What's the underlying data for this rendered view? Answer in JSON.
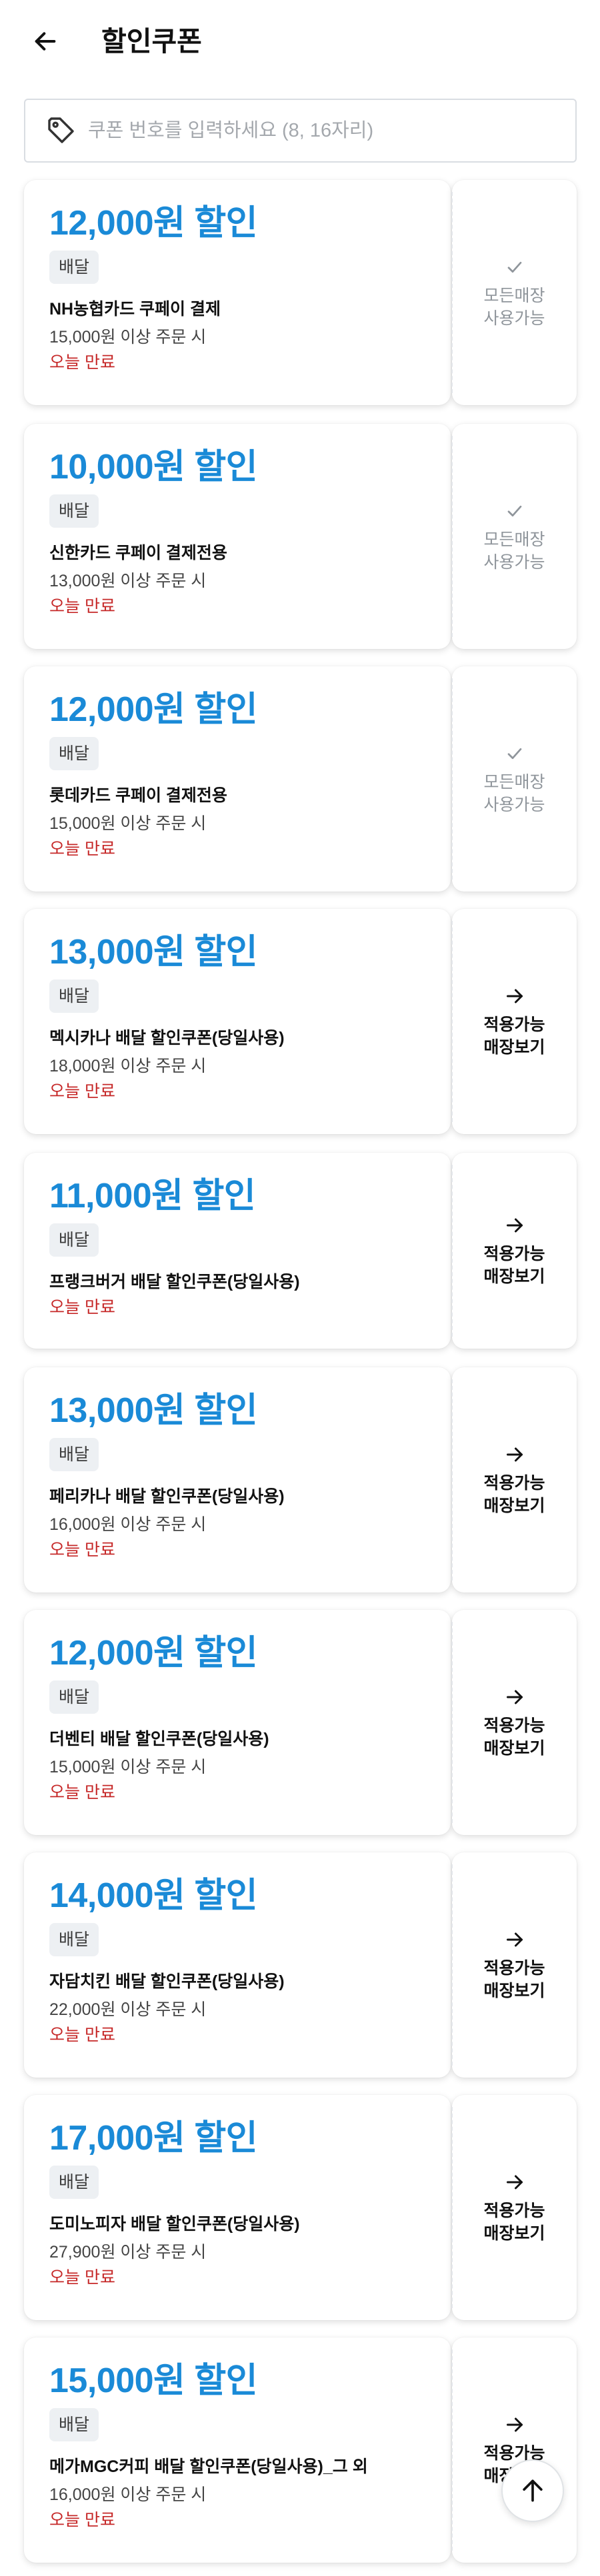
{
  "header": {
    "title": "할인쿠폰",
    "back_icon": "arrow-left-icon"
  },
  "search": {
    "placeholder": "쿠폰 번호를 입력하세요 (8, 16자리)",
    "value": "",
    "icon": "tag-icon"
  },
  "coupons": [
    {
      "amount": "12,000원 할인",
      "type": "배달",
      "name": "NH농협카드 쿠페이 결제",
      "min_order": "15,000원 이상 주문 시",
      "expiry": "오늘 만료",
      "side": {
        "kind": "all",
        "icon": "check-icon",
        "line1": "모든매장",
        "line2": "사용가능"
      }
    },
    {
      "amount": "10,000원 할인",
      "type": "배달",
      "name": "신한카드 쿠페이 결제전용",
      "min_order": "13,000원 이상 주문 시",
      "expiry": "오늘 만료",
      "side": {
        "kind": "all",
        "icon": "check-icon",
        "line1": "모든매장",
        "line2": "사용가능"
      }
    },
    {
      "amount": "12,000원 할인",
      "type": "배달",
      "name": "롯데카드 쿠페이 결제전용",
      "min_order": "15,000원 이상 주문 시",
      "expiry": "오늘 만료",
      "side": {
        "kind": "all",
        "icon": "check-icon",
        "line1": "모든매장",
        "line2": "사용가능"
      }
    },
    {
      "amount": "13,000원 할인",
      "type": "배달",
      "name": "멕시카나 배달 할인쿠폰(당일사용)",
      "min_order": "18,000원 이상 주문 시",
      "expiry": "오늘 만료",
      "side": {
        "kind": "store",
        "icon": "arrow-right-icon",
        "line1": "적용가능",
        "line2": "매장보기"
      }
    },
    {
      "amount": "11,000원 할인",
      "type": "배달",
      "name": "프랭크버거 배달 할인쿠폰(당일사용)",
      "min_order": "",
      "expiry": "오늘 만료",
      "side": {
        "kind": "store",
        "icon": "arrow-right-icon",
        "line1": "적용가능",
        "line2": "매장보기"
      }
    },
    {
      "amount": "13,000원 할인",
      "type": "배달",
      "name": "페리카나 배달 할인쿠폰(당일사용)",
      "min_order": "16,000원 이상 주문 시",
      "expiry": "오늘 만료",
      "side": {
        "kind": "store",
        "icon": "arrow-right-icon",
        "line1": "적용가능",
        "line2": "매장보기"
      }
    },
    {
      "amount": "12,000원 할인",
      "type": "배달",
      "name": "더벤티 배달 할인쿠폰(당일사용)",
      "min_order": "15,000원 이상 주문 시",
      "expiry": "오늘 만료",
      "side": {
        "kind": "store",
        "icon": "arrow-right-icon",
        "line1": "적용가능",
        "line2": "매장보기"
      }
    },
    {
      "amount": "14,000원 할인",
      "type": "배달",
      "name": "자담치킨 배달 할인쿠폰(당일사용)",
      "min_order": "22,000원 이상 주문 시",
      "expiry": "오늘 만료",
      "side": {
        "kind": "store",
        "icon": "arrow-right-icon",
        "line1": "적용가능",
        "line2": "매장보기"
      }
    },
    {
      "amount": "17,000원 할인",
      "type": "배달",
      "name": "도미노피자 배달 할인쿠폰(당일사용)",
      "min_order": "27,900원 이상 주문 시",
      "expiry": "오늘 만료",
      "side": {
        "kind": "store",
        "icon": "arrow-right-icon",
        "line1": "적용가능",
        "line2": "매장보기"
      }
    },
    {
      "amount": "15,000원 할인",
      "type": "배달",
      "name": "메가MGC커피 배달 할인쿠폰(당일사용)_그 외",
      "min_order": "16,000원 이상 주문 시",
      "expiry": "오늘 만료",
      "side": {
        "kind": "store",
        "icon": "arrow-right-icon",
        "line1": "적용가능",
        "line2": "매장보기"
      }
    }
  ],
  "scroll_top": {
    "icon": "arrow-up-icon"
  },
  "colors": {
    "accent": "#1a8ad7",
    "expiry": "#c62828",
    "muted": "#8f959b"
  }
}
